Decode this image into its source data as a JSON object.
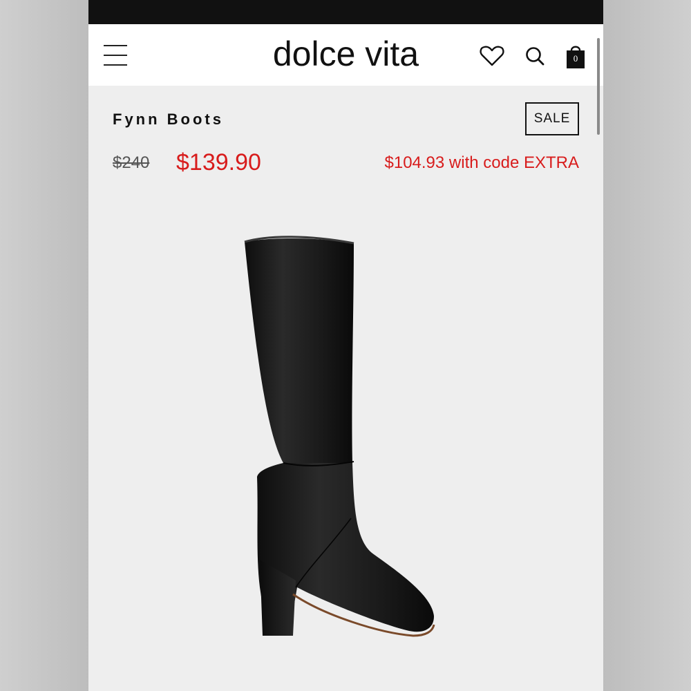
{
  "header": {
    "logo": "dolce vita",
    "bag_count": "0",
    "icons": [
      "menu-icon",
      "heart-icon",
      "search-icon",
      "bag-icon"
    ]
  },
  "product": {
    "title": "Fynn Boots",
    "badge": "SALE",
    "original_price": "$240",
    "sale_price": "$139.90",
    "promo_text": "$104.93 with code EXTRA"
  },
  "colors": {
    "sale_red": "#d81c1c",
    "text_dark": "#111111",
    "page_bg": "#eeeeee"
  }
}
